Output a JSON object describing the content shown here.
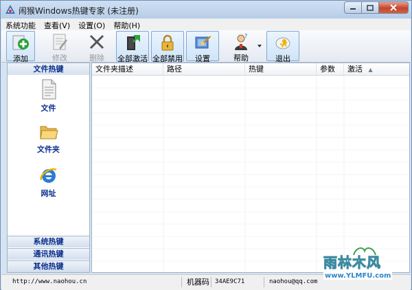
{
  "window": {
    "title": "闹猴Windows热键专家 (未注册)"
  },
  "menu": [
    {
      "label": "系统功能"
    },
    {
      "label": "查看(V)"
    },
    {
      "label": "设置(O)"
    },
    {
      "label": "帮助(H)"
    }
  ],
  "toolbar": {
    "add": "添加",
    "edit": "修改",
    "delete": "删除",
    "activate_all": "全部激活",
    "disable_all": "全部禁用",
    "settings": "设置",
    "help": "帮助",
    "exit": "退出"
  },
  "sidebar": {
    "header": "文件热键",
    "items": [
      {
        "label": "文件",
        "icon": "document-icon"
      },
      {
        "label": "文件夹",
        "icon": "folder-icon"
      },
      {
        "label": "网址",
        "icon": "ie-icon"
      }
    ],
    "sections": [
      "系统热键",
      "通讯热键",
      "其他热键"
    ]
  },
  "list": {
    "columns": [
      "文件夹描述",
      "路径",
      "热键",
      "参数",
      "激活"
    ],
    "sort_indicator": "▲",
    "rows": []
  },
  "status": {
    "url": "http://www.naohou.cn",
    "machine_label": "机器码",
    "machine_code": "34AE9C71",
    "email": "naohou@qq.com"
  },
  "watermark": {
    "text": "雨林木风",
    "url": "www.YLMFU.com"
  },
  "colors": {
    "titlebar": "#bcd1ea",
    "sidebar_text": "#0b2f8e",
    "close_button": "#c4452c"
  }
}
